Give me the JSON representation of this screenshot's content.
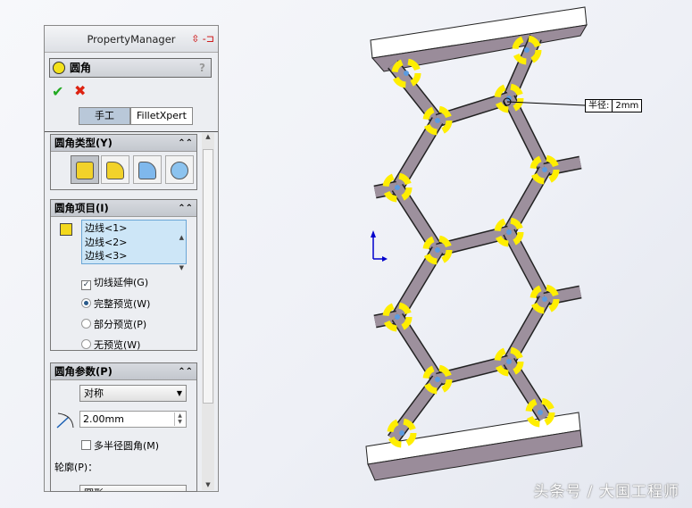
{
  "panel": {
    "title": "PropertyManager",
    "feature_name": "圆角",
    "help": "?",
    "tabs": [
      {
        "label": "手工"
      },
      {
        "label": "FilletXpert"
      }
    ],
    "fillet_type": {
      "title": "圆角类型(Y)"
    },
    "fillet_items": {
      "title": "圆角项目(I)",
      "edges": [
        "边线<1>",
        "边线<2>",
        "边线<3>"
      ],
      "tangent_propagation": "切线延伸(G)",
      "full_preview": "完整预览(W)",
      "partial_preview": "部分预览(P)",
      "no_preview": "无预览(W)"
    },
    "fillet_params": {
      "title": "圆角参数(P)",
      "method": "对称",
      "radius": "2.00mm",
      "multi_radius": "多半径圆角(M)",
      "profile_label": "轮廓(P)：",
      "profile_value": "圆形"
    }
  },
  "callout": {
    "label": "半径:",
    "value": "2mm"
  },
  "watermark": "头条号 / 大国工程师"
}
